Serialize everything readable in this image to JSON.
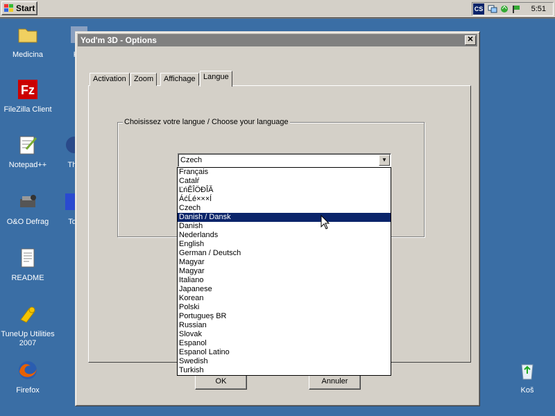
{
  "taskbar": {
    "start_label": "Start",
    "tray_badge": "CS",
    "clock": "5:51"
  },
  "desktop": {
    "icons": [
      {
        "label": "Medicina",
        "icon": "folder-icon"
      },
      {
        "label": "FileZilla Client",
        "icon": "filezilla-icon"
      },
      {
        "label": "Notepad++",
        "icon": "notepad-icon"
      },
      {
        "label": "O&O Defrag",
        "icon": "defrag-icon"
      },
      {
        "label": "README",
        "icon": "document-icon"
      },
      {
        "label": "TuneUp Utilities 2007",
        "icon": "tuneup-icon"
      },
      {
        "label": "Firefox",
        "icon": "firefox-icon"
      },
      {
        "label": "Koš",
        "icon": "recycle-bin-icon"
      }
    ],
    "partial_labels": [
      "KM",
      "Thu",
      "To"
    ]
  },
  "dialog": {
    "title": "Yod'm 3D - Options",
    "close_glyph": "✕",
    "tabs": [
      {
        "label": "Activation",
        "active": false
      },
      {
        "label": "Zoom",
        "active": false
      },
      {
        "label": "Affichage",
        "active": false
      },
      {
        "label": "Langue",
        "active": true
      }
    ],
    "group_label": "Choisissez votre langue / Choose your language",
    "combo_value": "Czech",
    "ok_label": "OK",
    "cancel_label": "Annuler"
  },
  "dropdown": {
    "selected_index": 5,
    "options": [
      "Français",
      "Catalŕ",
      "ĽńĚÎÖĐÎĂ",
      "ÁćĹé×××ĺ",
      "Czech",
      "Danish / Dansk",
      "Danish",
      "Nederlands",
      "English",
      "German / Deutsch",
      "Magyar",
      "Magyar",
      "Italiano",
      "Japanese",
      "Korean",
      "Polski",
      "Portugueș BR",
      "Russian",
      "Slovak",
      "Espanol",
      "Espanol Latino",
      "Swedish",
      "Turkish"
    ]
  },
  "colors": {
    "desktop": "#3a6ea5",
    "face": "#d4d0c8",
    "selection": "#0a246a",
    "inactive_title": "#808080"
  }
}
